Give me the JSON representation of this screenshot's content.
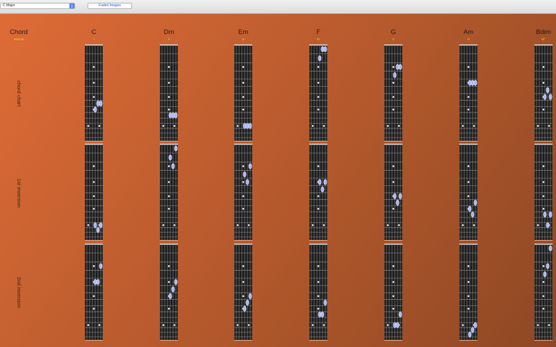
{
  "toolbar": {
    "key_select_value": "C Major",
    "faded_images_label": "Faded Images"
  },
  "header": {
    "chord_label": "Chord",
    "interval_label": "Interval"
  },
  "row_labels": [
    "chord chart",
    "1st inversion",
    "2nd inversion"
  ],
  "colors": {
    "background_light": "#df6c37",
    "background_dark": "#8e4823",
    "interval_text": "#f5d51f",
    "fretboard": "#1c1c1c",
    "chord_tone": "#a9b5f5",
    "select_arrow": "#3d7ef0"
  },
  "chords": [
    {
      "name": "C",
      "interval": "I",
      "voicings": [
        [
          {
            "string": 3,
            "fret": 9
          },
          {
            "string": 2,
            "fret": 8
          },
          {
            "string": 1,
            "fret": 8
          }
        ],
        [
          {
            "string": 3,
            "fret": 12
          },
          {
            "string": 2,
            "fret": 13
          },
          {
            "string": 1,
            "fret": 12
          }
        ],
        [
          {
            "string": 3,
            "fret": 5
          },
          {
            "string": 2,
            "fret": 5
          },
          {
            "string": 1,
            "fret": 3
          }
        ]
      ]
    },
    {
      "name": "Dm",
      "interval": "ii",
      "voicings": [
        [
          {
            "string": 3,
            "fret": 10
          },
          {
            "string": 2,
            "fret": 10
          },
          {
            "string": 1,
            "fret": 10
          }
        ],
        [
          {
            "string": 3,
            "fret": 2
          },
          {
            "string": 2,
            "fret": 3
          },
          {
            "string": 1,
            "fret": 1
          }
        ],
        [
          {
            "string": 3,
            "fret": 7
          },
          {
            "string": 2,
            "fret": 6
          },
          {
            "string": 1,
            "fret": 5
          }
        ]
      ]
    },
    {
      "name": "Em",
      "interval": "iii",
      "voicings": [
        [
          {
            "string": 3,
            "fret": 12
          },
          {
            "string": 2,
            "fret": 12
          },
          {
            "string": 1,
            "fret": 12
          }
        ],
        [
          {
            "string": 3,
            "fret": 4
          },
          {
            "string": 2,
            "fret": 5
          },
          {
            "string": 1,
            "fret": 3
          }
        ],
        [
          {
            "string": 3,
            "fret": 9
          },
          {
            "string": 2,
            "fret": 8
          },
          {
            "string": 1,
            "fret": 7
          }
        ]
      ]
    },
    {
      "name": "F",
      "interval": "IV",
      "voicings": [
        [
          {
            "string": 3,
            "fret": 2
          },
          {
            "string": 2,
            "fret": 1
          },
          {
            "string": 1,
            "fret": 1
          }
        ],
        [
          {
            "string": 3,
            "fret": 5
          },
          {
            "string": 2,
            "fret": 6
          },
          {
            "string": 1,
            "fret": 5
          }
        ],
        [
          {
            "string": 3,
            "fret": 10
          },
          {
            "string": 2,
            "fret": 10
          },
          {
            "string": 1,
            "fret": 8
          }
        ]
      ]
    },
    {
      "name": "G",
      "interval": "V",
      "voicings": [
        [
          {
            "string": 3,
            "fret": 4
          },
          {
            "string": 2,
            "fret": 3
          },
          {
            "string": 1,
            "fret": 3
          }
        ],
        [
          {
            "string": 3,
            "fret": 7
          },
          {
            "string": 2,
            "fret": 8
          },
          {
            "string": 1,
            "fret": 7
          }
        ],
        [
          {
            "string": 3,
            "fret": 12
          },
          {
            "string": 2,
            "fret": 12
          },
          {
            "string": 1,
            "fret": 10
          }
        ]
      ]
    },
    {
      "name": "Am",
      "interval": "vi",
      "voicings": [
        [
          {
            "string": 3,
            "fret": 5
          },
          {
            "string": 2,
            "fret": 5
          },
          {
            "string": 1,
            "fret": 5
          }
        ],
        [
          {
            "string": 3,
            "fret": 9
          },
          {
            "string": 2,
            "fret": 10
          },
          {
            "string": 1,
            "fret": 8
          }
        ],
        [
          {
            "string": 3,
            "fret": 14
          },
          {
            "string": 2,
            "fret": 13
          },
          {
            "string": 1,
            "fret": 12
          }
        ]
      ]
    },
    {
      "name": "Bdim",
      "interval": "vii°",
      "voicings": [
        [
          {
            "string": 3,
            "fret": 7
          },
          {
            "string": 2,
            "fret": 6
          },
          {
            "string": 1,
            "fret": 7
          }
        ],
        [
          {
            "string": 3,
            "fret": 10
          },
          {
            "string": 2,
            "fret": 12
          },
          {
            "string": 1,
            "fret": 10
          }
        ],
        [
          {
            "string": 3,
            "fret": 4
          },
          {
            "string": 2,
            "fret": 3
          },
          {
            "string": 1,
            "fret": 1
          }
        ]
      ]
    }
  ]
}
